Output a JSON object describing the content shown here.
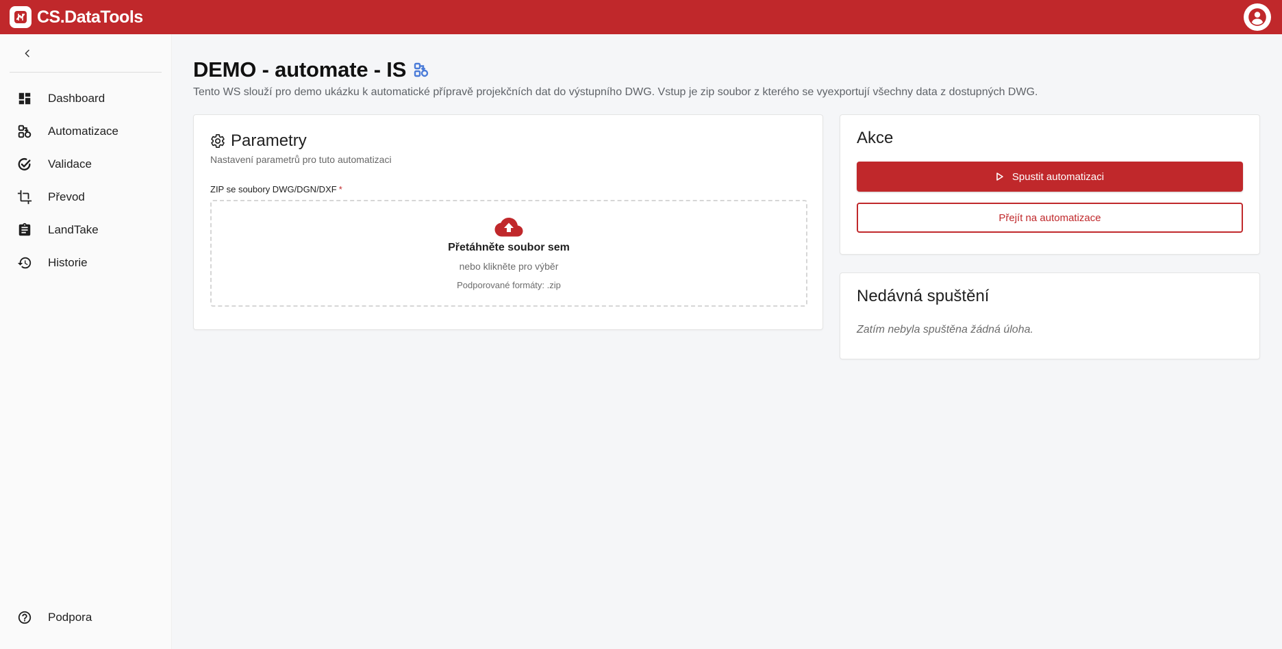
{
  "app": {
    "name": "CS.DataTools"
  },
  "sidebar": {
    "items": [
      {
        "label": "Dashboard",
        "icon": "dashboard-icon"
      },
      {
        "label": "Automatizace",
        "icon": "automation-icon"
      },
      {
        "label": "Validace",
        "icon": "validation-icon"
      },
      {
        "label": "Převod",
        "icon": "crop-icon"
      },
      {
        "label": "LandTake",
        "icon": "clipboard-icon"
      },
      {
        "label": "Historie",
        "icon": "history-icon"
      }
    ],
    "bottom": {
      "label": "Podpora",
      "icon": "help-icon"
    }
  },
  "page": {
    "title": "DEMO - automate - IS",
    "description": "Tento WS slouží pro demo ukázku k automatické přípravě projekčních dat do výstupního DWG. Vstup je zip soubor z kterého se vyexportují všechny data z dostupných DWG."
  },
  "params": {
    "title": "Parametry",
    "subtitle": "Nastavení parametrů pro tuto automatizaci",
    "field_label": "ZIP se soubory DWG/DGN/DXF",
    "required_mark": "*",
    "dropzone": {
      "title": "Přetáhněte soubor sem",
      "subtitle": "nebo klikněte pro výběr",
      "formats": "Podporované formáty: .zip"
    }
  },
  "actions": {
    "title": "Akce",
    "run_label": "Spustit automatizaci",
    "goto_label": "Přejít na automatizace"
  },
  "recent": {
    "title": "Nedávná spuštění",
    "empty": "Zatím nebyla spuštěna žádná úloha."
  },
  "colors": {
    "brand": "#c0282b",
    "accent_icon": "#4a7bd8",
    "background": "#f5f6f8"
  }
}
